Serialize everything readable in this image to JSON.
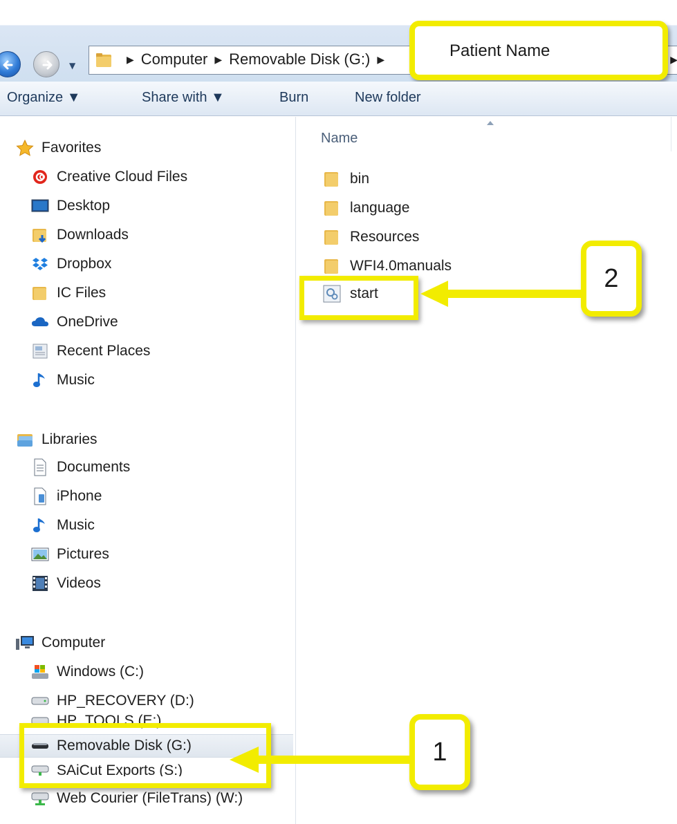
{
  "breadcrumb": {
    "items": [
      "Computer",
      "Removable Disk (G:)"
    ],
    "current": "Patient Name"
  },
  "toolbar": {
    "organize": "Organize ▼",
    "share_with": "Share with ▼",
    "burn": "Burn",
    "new_folder": "New folder"
  },
  "nav": {
    "favorites_header": "Favorites",
    "favorites": [
      "Creative Cloud Files",
      "Desktop",
      "Downloads",
      "Dropbox",
      "IC Files",
      "OneDrive",
      "Recent Places",
      "Music"
    ],
    "libraries_header": "Libraries",
    "libraries": [
      "Documents",
      "iPhone",
      "Music",
      "Pictures",
      "Videos"
    ],
    "computer_header": "Computer",
    "drives": [
      "Windows (C:)",
      "HP_RECOVERY (D:)",
      "HP_TOOLS (E:)",
      "Removable Disk (G:)",
      "SAiCut Exports (S:)",
      "Web Courier (FileTrans) (W:)"
    ]
  },
  "content": {
    "column_name": "Name",
    "files": [
      "bin",
      "language",
      "Resources",
      "WFI4.0manuals",
      "start"
    ]
  },
  "callouts": {
    "one": "1",
    "two": "2"
  },
  "colors": {
    "highlight": "#f2ec00",
    "folder": "#e8b84a"
  }
}
